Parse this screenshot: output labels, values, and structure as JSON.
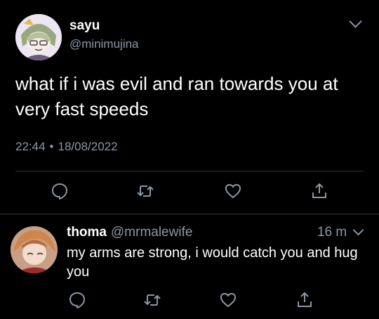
{
  "main_tweet": {
    "display_name": "sayu",
    "handle": "@minimujina",
    "text": "what if i was evil and ran towards you at very fast speeds",
    "time": "22:44",
    "separator": "•",
    "date": "18/08/2022"
  },
  "reply": {
    "display_name": "thoma",
    "handle": "@mrmalewife",
    "time": "16 m",
    "text": "my arms are strong, i would catch you and hug you"
  },
  "colors": {
    "background": "#000000",
    "primary_text": "#ffffff",
    "secondary_text": "#8b98a5",
    "divider": "#2f3336"
  },
  "icons": {
    "reply": "speech-bubble-icon",
    "retweet": "retweet-icon",
    "like": "heart-icon",
    "share": "share-icon",
    "menu": "chevron-down-icon"
  }
}
